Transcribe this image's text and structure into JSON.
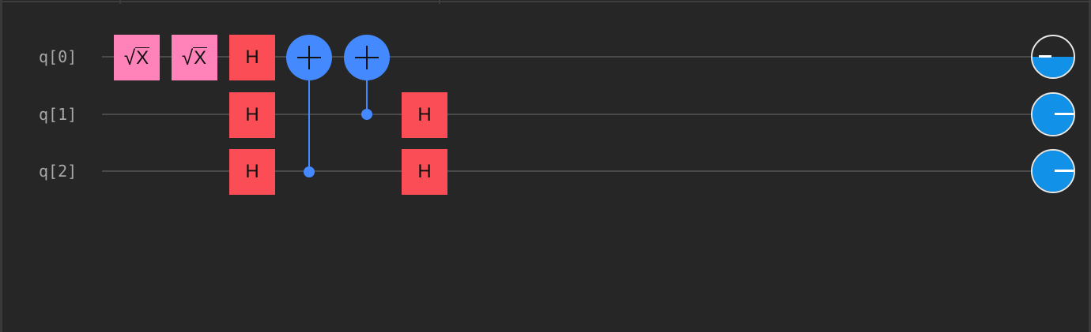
{
  "circuit": {
    "qubits": [
      {
        "label": "q[0]",
        "probability_one": 0.5
      },
      {
        "label": "q[1]",
        "probability_one": 1.0
      },
      {
        "label": "q[2]",
        "probability_one": 1.0
      }
    ],
    "gates": {
      "sx_label_root": "√",
      "sx_label_x": "X",
      "h_label": "H"
    },
    "colors": {
      "sx_gate": "#ff82b9",
      "h_gate": "#fa4d56",
      "cnot": "#4589ff",
      "probability": "#1192e8",
      "background": "#262626"
    },
    "operations": [
      {
        "gate": "SX",
        "qubit": 0,
        "step": 0
      },
      {
        "gate": "SX",
        "qubit": 0,
        "step": 1
      },
      {
        "gate": "H",
        "qubit": 0,
        "step": 2
      },
      {
        "gate": "H",
        "qubit": 1,
        "step": 2
      },
      {
        "gate": "H",
        "qubit": 2,
        "step": 2
      },
      {
        "gate": "CX",
        "control": 2,
        "target": 0,
        "step": 3
      },
      {
        "gate": "CX",
        "control": 1,
        "target": 0,
        "step": 4
      },
      {
        "gate": "H",
        "qubit": 1,
        "step": 5
      },
      {
        "gate": "H",
        "qubit": 2,
        "step": 5
      }
    ]
  }
}
